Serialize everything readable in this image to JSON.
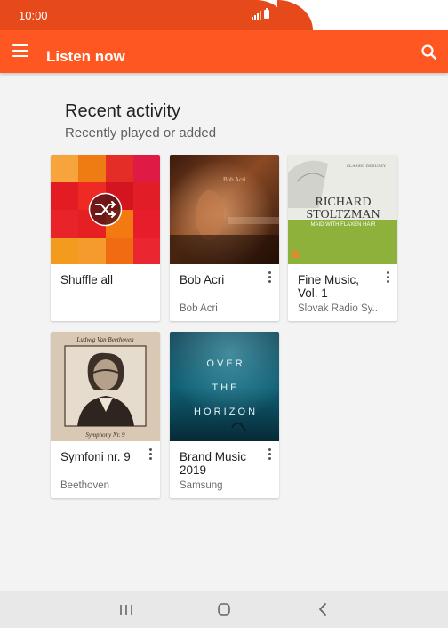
{
  "status_bar": {
    "time": "10:00"
  },
  "app_bar": {
    "title": "Listen now"
  },
  "section": {
    "title": "Recent activity",
    "subtitle": "Recently played or added"
  },
  "cards": [
    {
      "title": "Shuffle all",
      "subtitle": ""
    },
    {
      "title": "Bob Acri",
      "subtitle": "Bob Acri",
      "art_text": "Bob Acri"
    },
    {
      "title": "Fine Music, Vol. 1",
      "subtitle": "Slovak Radio Sy..",
      "art_top": "CLASSIC DEBUSSY",
      "art_name_1": "RICHARD",
      "art_name_2": "STOLTZMAN",
      "art_caption": "MAID WITH FLAXEN HAIR"
    },
    {
      "title": "Symfoni nr. 9",
      "subtitle": "Beethoven",
      "art_top": "Ludwig Van Beethoven",
      "art_bottom": "Symphony Nr. 9"
    },
    {
      "title": "Brand Music 2019",
      "subtitle": "Samsung",
      "art_line_1": "O V E R",
      "art_line_2": "T H E",
      "art_line_3": "H O R I Z O N"
    }
  ],
  "colors": {
    "accent": "#ff5722",
    "status": "#e6491a"
  }
}
